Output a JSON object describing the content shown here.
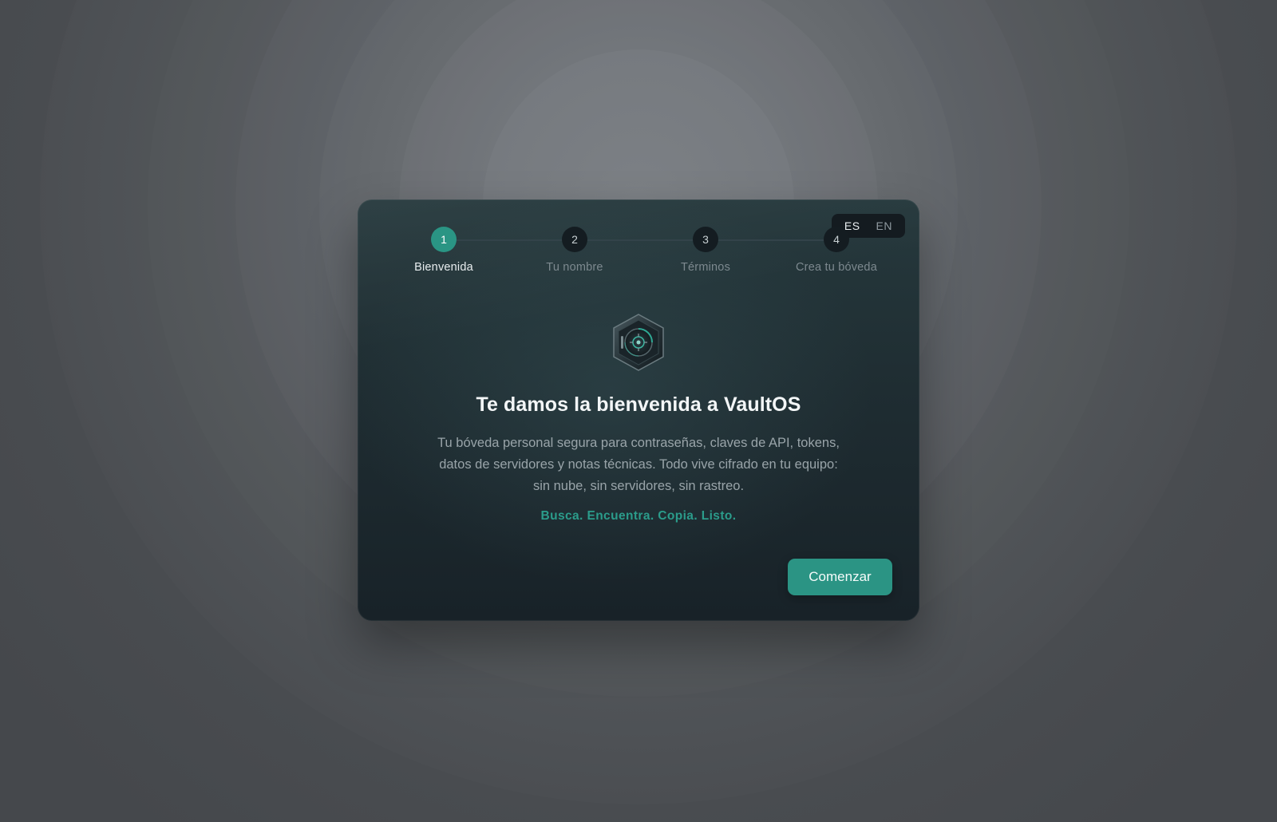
{
  "language": {
    "options": [
      "ES",
      "EN"
    ],
    "selected": "ES"
  },
  "steps": [
    {
      "number": "1",
      "label": "Bienvenida",
      "active": true
    },
    {
      "number": "2",
      "label": "Tu nombre",
      "active": false
    },
    {
      "number": "3",
      "label": "Términos",
      "active": false
    },
    {
      "number": "4",
      "label": "Crea tu bóveda",
      "active": false
    }
  ],
  "emblem": {
    "icon": "vault-shield-icon"
  },
  "welcome": {
    "title": "Te damos la bienvenida a VaultOS",
    "description": "Tu bóveda personal segura para contraseñas, claves de API, tokens, datos de servidores y notas técnicas. Todo vive cifrado en tu equipo: sin nube, sin servidores, sin rastreo.",
    "tagline": "Busca. Encuentra. Copia. Listo."
  },
  "actions": {
    "start_label": "Comenzar"
  },
  "colors": {
    "accent": "#2b9484",
    "dialog_background": "#1f2d32",
    "page_background": "#5f6368"
  }
}
